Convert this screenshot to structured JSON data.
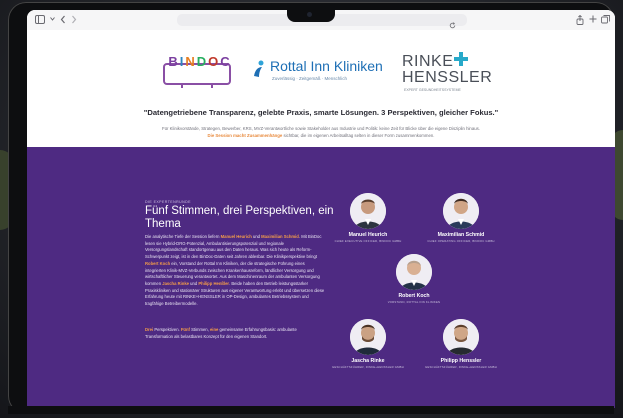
{
  "browser": {
    "icons": [
      "sidebar-icon",
      "back-icon",
      "forward-icon",
      "reload-icon",
      "share-icon",
      "new-tab-icon",
      "tabs-icon"
    ]
  },
  "logos": {
    "bindoc": "BINDOC",
    "rottal": {
      "name": "Rottal Inn Kliniken",
      "sub": "Zuverlässig · Zeitgemäß · Menschlich"
    },
    "rinke": {
      "line1": "RINKE",
      "line2": "HENSSLER",
      "sub": "EXPERT GESUNDHEITSSYSTEME"
    }
  },
  "hero": {
    "quote": "\"Datengetriebene Transparenz, gelebte Praxis, smarte Lösungen. 3 Perspektiven, gleicher Fokus.\"",
    "intro_a": "Für Klinikvorstände, Strategen, Bewerber, KRS, MVZ-Verantwortliche sowie Stakeholder aus Industrie und Politik: keine Zeit für Blicke über die eigene Disziplin hinaus.",
    "intro_hl": "Die Session macht Zusammenhänge",
    "intro_b": " sichtbar, die im eigenen Arbeitsalltag selten in dieser Form zusammenkommen."
  },
  "section": {
    "eyebrow": "DIE EXPERTENRUNDE",
    "title": "Fünf Stimmen, drei Perspektiven, ein Thema",
    "p1_a": "Die analytische Tiefe der Session liefern ",
    "p1_hl1": "Manuel Heurich",
    "p1_b": " und ",
    "p1_hl2": "Maximilian Schmid",
    "p1_c": ". Mit BinDoc lesen sie Hybrid-DRG-Potenzial, Ambulantisierungspotenzial und regionale Versorgungslandschaft standortgenau aus den Daten heraus. Was sich heute als Reform-Schwerpunkt zeigt, ist in den BinDoc-Daten seit Jahren ablesbar. Die Klinikperspektive bringt ",
    "p1_hl3": "Robert Koch",
    "p1_d": " ein, Vorstand der Rottal Inn Kliniken, der die strategische Führung eines integrierten Klinik-MVZ-Verbunds zwischen Krankenhausreform, ländlicher Versorgung und wirtschaftlicher Steuerung verantwortet. Aus dem Maschinenraum der ambulanten Versorgung kommen ",
    "p1_hl4": "Jascha Rinke",
    "p1_e": " und ",
    "p1_hl5": "Philipp Henßler",
    "p1_f": ". Beide haben den Betrieb leistungsstarker Praxiskliniken und stationärer Strukturen aus eigener Verantwortung erlebt und übersetzen diese Erfahrung heute mit RINKE+HENSSLER in OP-Design, ambulantes Betriebssystem und tragfähige Betreibermodelle.",
    "p2_hl1": "Drei",
    "p2_a": " Perspektiven. ",
    "p2_hl2": "Fünf",
    "p2_b": " Stimmen, ",
    "p2_hl3": "eine",
    "p2_c": " gemeinsame Erfahrungsbasis: ambulante Transformation als belastbares Konzept für den eigenen Standort."
  },
  "speakers": [
    {
      "name": "Manuel Heurich",
      "role": "CHIEF EXECUTIVE OFFICER, BINDOC GMBH"
    },
    {
      "name": "Maximilian Schmid",
      "role": "CHIEF OPERATING OFFICER, BINDOC GMBH"
    },
    {
      "name": "Robert Koch",
      "role": "VORSTAND, ROTTAL INN KLINIKEN"
    },
    {
      "name": "Jascha Rinke",
      "role": "GESCHÄFTSFÜHRER, RINKE+HENSSLER GMBH"
    },
    {
      "name": "Philipp Henssler",
      "role": "GESCHÄFTSFÜHRER, RINKE+HENSSLER GMBH"
    }
  ],
  "colors": {
    "purple": "#4e2a82",
    "accent": "#f39c4a",
    "rottal_blue": "#1e6fb5",
    "rinke_cross": "#27a9c9"
  }
}
